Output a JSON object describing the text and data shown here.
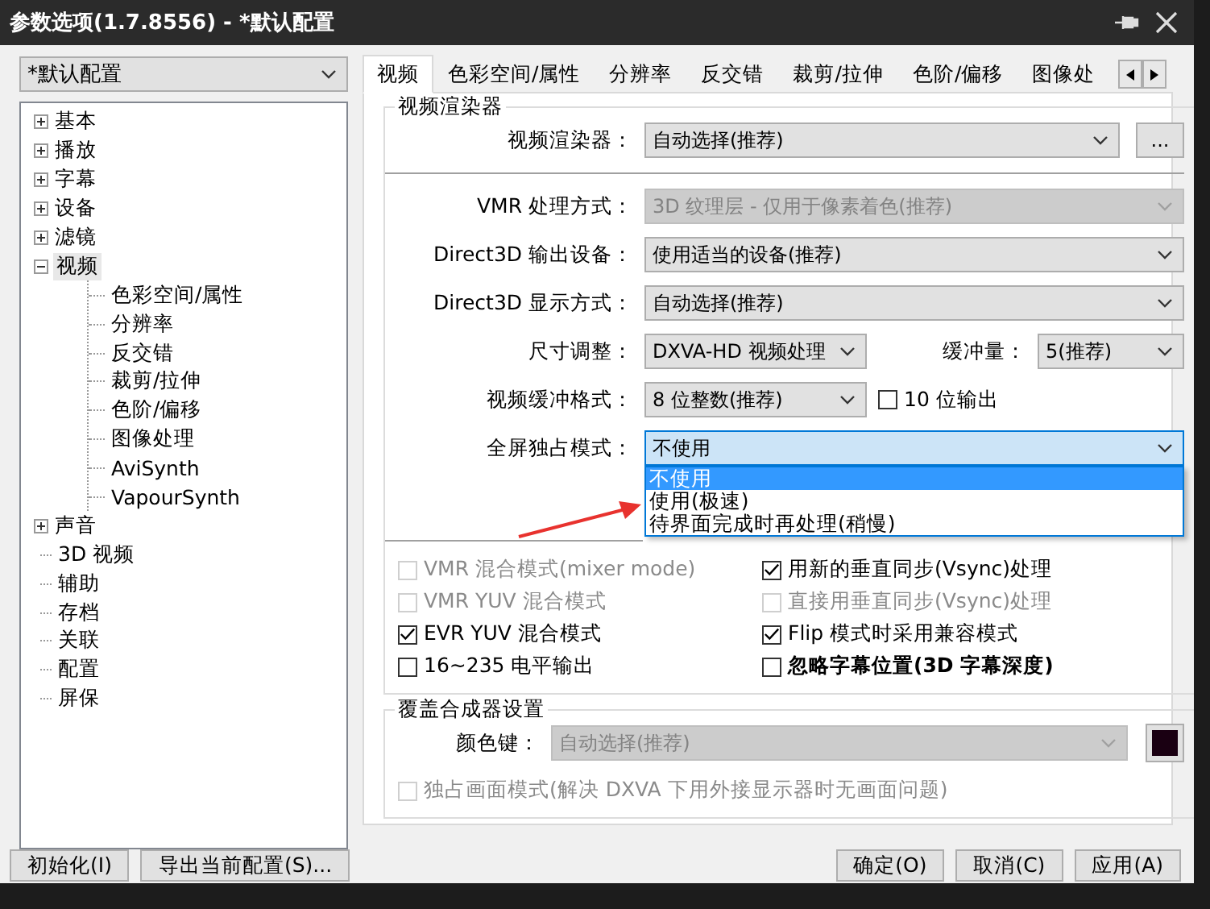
{
  "window": {
    "title": "参数选项(1.7.8556) - *默认配置"
  },
  "profile": {
    "value": "*默认配置"
  },
  "tree": [
    {
      "label": "基本",
      "expandable": true,
      "expanded": false,
      "selected": false
    },
    {
      "label": "播放",
      "expandable": true,
      "expanded": false,
      "selected": false
    },
    {
      "label": "字幕",
      "expandable": true,
      "expanded": false,
      "selected": false
    },
    {
      "label": "设备",
      "expandable": true,
      "expanded": false,
      "selected": false
    },
    {
      "label": "滤镜",
      "expandable": true,
      "expanded": false,
      "selected": false
    },
    {
      "label": "视频",
      "expandable": true,
      "expanded": true,
      "selected": true,
      "children": [
        {
          "label": "色彩空间/属性"
        },
        {
          "label": "分辨率"
        },
        {
          "label": "反交错"
        },
        {
          "label": "裁剪/拉伸"
        },
        {
          "label": "色阶/偏移"
        },
        {
          "label": "图像处理"
        },
        {
          "label": "AviSynth"
        },
        {
          "label": "VapourSynth"
        }
      ]
    },
    {
      "label": "声音",
      "expandable": true,
      "expanded": false,
      "selected": false
    },
    {
      "label": "3D 视频",
      "expandable": false,
      "selected": false
    },
    {
      "label": "辅助",
      "expandable": false,
      "selected": false
    },
    {
      "label": "存档",
      "expandable": false,
      "selected": false
    },
    {
      "label": "关联",
      "expandable": false,
      "selected": false
    },
    {
      "label": "配置",
      "expandable": false,
      "selected": false
    },
    {
      "label": "屏保",
      "expandable": false,
      "selected": false
    }
  ],
  "tabs": [
    {
      "label": "视频",
      "selected": true
    },
    {
      "label": "色彩空间/属性",
      "selected": false
    },
    {
      "label": "分辨率",
      "selected": false
    },
    {
      "label": "反交错",
      "selected": false
    },
    {
      "label": "裁剪/拉伸",
      "selected": false
    },
    {
      "label": "色阶/偏移",
      "selected": false
    },
    {
      "label": "图像处",
      "selected": false
    }
  ],
  "renderer_group": {
    "title": "视频渲染器",
    "renderer": {
      "label": "视频渲染器：",
      "value": "自动选择(推荐)",
      "disabled": false,
      "button": "..."
    },
    "settings": [
      {
        "label": "VMR 处理方式：",
        "value": "3D 纹理层 - 仅用于像素着色(推荐)",
        "disabled": true
      },
      {
        "label": "Direct3D 输出设备：",
        "value": "使用适当的设备(推荐)",
        "disabled": false
      },
      {
        "label": "Direct3D 显示方式：",
        "value": "自动选择(推荐)",
        "disabled": false
      }
    ],
    "resize": {
      "label": "尺寸调整：",
      "value": "DXVA-HD 视频处理",
      "disabled": false
    },
    "buffer": {
      "label": "缓冲量：",
      "value": "5(推荐)",
      "disabled": false
    },
    "buffer_format": {
      "label": "视频缓冲格式：",
      "value": "8 位整数(推荐)",
      "disabled": false
    },
    "ten_bit": {
      "label": "10 位输出",
      "checked": false,
      "disabled": false,
      "bold": false
    },
    "fullscreen": {
      "label": "全屏独占模式：",
      "value": "不使用",
      "disabled": false,
      "open": true,
      "options": [
        {
          "label": "不使用",
          "selected": true
        },
        {
          "label": "使用(极速)",
          "selected": false
        },
        {
          "label": "待界面完成时再处理(稍慢)",
          "selected": false
        }
      ]
    },
    "checkboxes": [
      {
        "label": "VMR 混合模式(mixer mode)",
        "checked": false,
        "disabled": true,
        "bold": false
      },
      {
        "label": "用新的垂直同步(Vsync)处理",
        "checked": true,
        "disabled": false,
        "bold": false
      },
      {
        "label": "VMR YUV 混合模式",
        "checked": false,
        "disabled": true,
        "bold": false
      },
      {
        "label": "直接用垂直同步(Vsync)处理",
        "checked": false,
        "disabled": true,
        "bold": false
      },
      {
        "label": "EVR YUV 混合模式",
        "checked": true,
        "disabled": false,
        "bold": false
      },
      {
        "label": "Flip 模式时采用兼容模式",
        "checked": true,
        "disabled": false,
        "bold": false
      },
      {
        "label": "16~235 电平输出",
        "checked": false,
        "disabled": false,
        "bold": false
      },
      {
        "label": "忽略字幕位置(3D 字幕深度)",
        "checked": false,
        "disabled": false,
        "bold": true
      }
    ]
  },
  "overlay_group": {
    "title": "覆盖合成器设置",
    "color_key": {
      "label": "颜色键：",
      "value": "自动选择(推荐)",
      "disabled": true,
      "color": "#1a0012"
    },
    "exclusive": {
      "label": "独占画面模式(解决 DXVA 下用外接显示器时无画面问题)",
      "checked": false,
      "disabled": true,
      "bold": false
    }
  },
  "left_buttons": [
    {
      "label": "初始化(I)"
    },
    {
      "label": "导出当前配置(S)..."
    }
  ],
  "right_buttons": [
    {
      "label": "确定(O)"
    },
    {
      "label": "取消(C)"
    },
    {
      "label": "应用(A)"
    }
  ]
}
